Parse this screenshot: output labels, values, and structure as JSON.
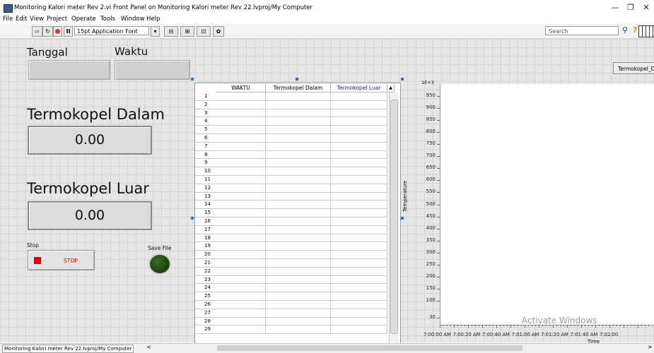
{
  "window": {
    "title": "Monitoring Kalori meter Rev 2.vi Front Panel on Monitoring Kalori meter Rev 22.lvproj/My Computer",
    "minimize": "—",
    "restore": "❐",
    "close": "✕"
  },
  "menu": [
    "File",
    "Edit",
    "View",
    "Project",
    "Operate",
    "Tools",
    "Window",
    "Help"
  ],
  "toolbar": {
    "font": "15pt Application Font",
    "search_placeholder": "Search"
  },
  "panel": {
    "tanggal_label": "Tanggal",
    "waktu_label": "Waktu",
    "termokopel_dalam_label": "Termokopel Dalam",
    "termokopel_dalam_value": "0.00",
    "termokopel_luar_label": "Termokopel Luar",
    "termokopel_luar_value": "0.00",
    "stop_label": "Stop",
    "stop_button": "STOP",
    "save_file_label": "Save File",
    "right_button": "Termokopel_D"
  },
  "table": {
    "columns": [
      "WAKTU",
      "Termokopel Dalam",
      "Termokopel Luar"
    ],
    "row_numbers": [
      "1",
      "2",
      "3",
      "4",
      "5",
      "6",
      "7",
      "8",
      "9",
      "10",
      "11",
      "12",
      "13",
      "14",
      "15",
      "16",
      "17",
      "18",
      "19",
      "20",
      "21",
      "22",
      "23",
      "24",
      "25",
      "26",
      "27",
      "28",
      "29"
    ]
  },
  "chart_data": {
    "type": "line",
    "ylabel": "Temperature",
    "xlabel": "Time",
    "y_multiplier": "1E+3",
    "ylim": [
      0,
      1000
    ],
    "y_ticks": [
      "950",
      "900",
      "850",
      "800",
      "750",
      "700",
      "650",
      "600",
      "550",
      "500",
      "450",
      "400",
      "350",
      "300",
      "250",
      "200",
      "150",
      "100",
      "30"
    ],
    "x_ticks": [
      "7:00:00 AM",
      "7:00:20 AM",
      "7:00:40 AM",
      "7:01:00 AM",
      "7:01:20 AM",
      "7:01:40 AM",
      "7:02:00"
    ],
    "series": []
  },
  "overlay": {
    "watermark": "Activate Windows"
  },
  "statusbar": {
    "path": "Monitoring Kalori meter Rev 22.lvproj/My Computer",
    "left_arrow": "<",
    "right_arrow": ">"
  },
  "colors": {
    "panel_bg": "#e6e6e6",
    "led_off": "#1e4a12",
    "stop_red": "#e10000",
    "luar_header": "#1a1acc"
  }
}
